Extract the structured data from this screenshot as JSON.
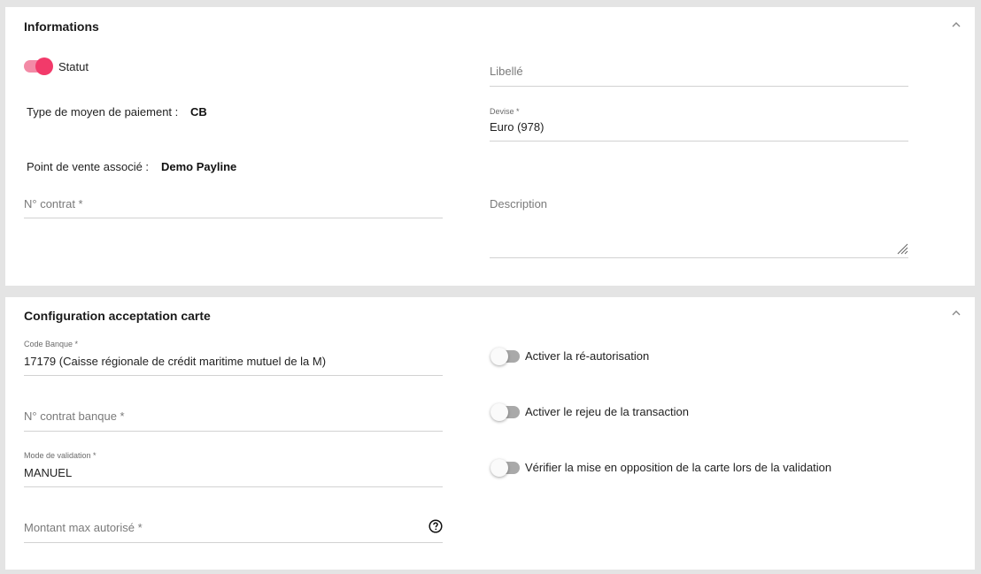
{
  "informations": {
    "title": "Informations",
    "statut_label": "Statut",
    "type_label": "Type de moyen de paiement :",
    "type_value": "CB",
    "point_label": "Point de vente associé :",
    "point_value": "Demo Payline",
    "contrat_placeholder": "N° contrat *",
    "libelle_placeholder": "Libellé",
    "devise_label": "Devise *",
    "devise_value": "Euro (978)",
    "description_placeholder": "Description"
  },
  "config": {
    "title": "Configuration acceptation carte",
    "code_banque_label": "Code Banque *",
    "code_banque_value": "17179 (Caisse régionale de crédit maritime mutuel de la M)",
    "contrat_banque_placeholder": "N° contrat banque *",
    "mode_label": "Mode de validation *",
    "mode_value": "MANUEL",
    "montant_placeholder": "Montant max autorisé *",
    "reautorisation_label": "Activer la ré-autorisation",
    "rejeu_label": "Activer le rejeu de la transaction",
    "opposition_label": "Vérifier la mise en opposition de la carte lors de la validation"
  },
  "colors": {
    "accent": "#f23a6a",
    "toggle_off": "#a9a9a9"
  }
}
